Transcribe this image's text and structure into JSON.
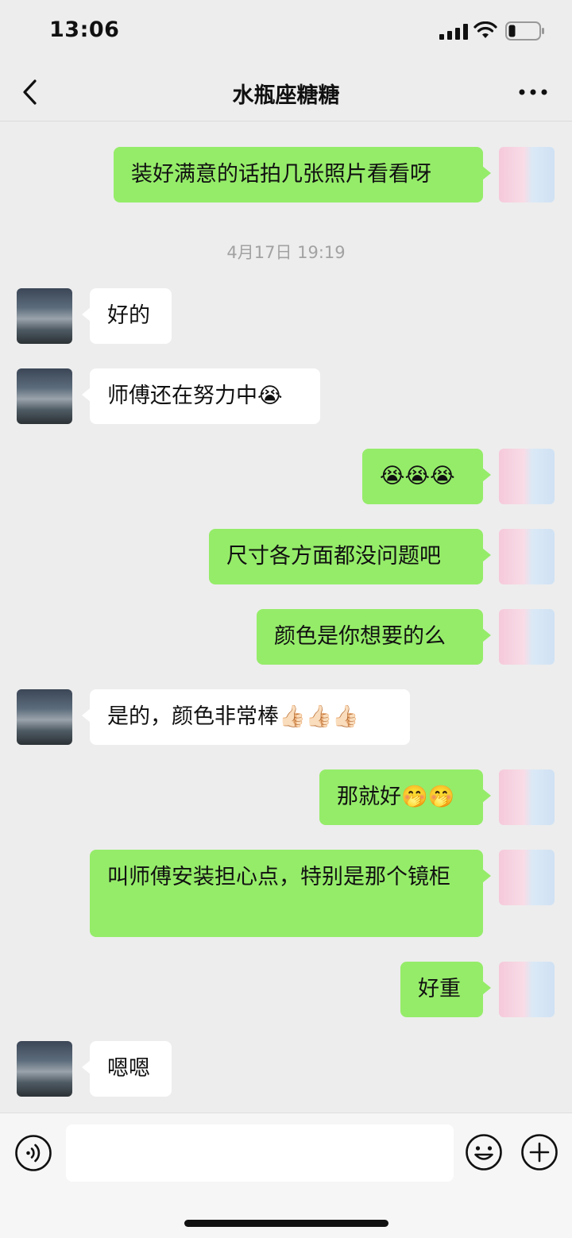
{
  "status_bar": {
    "time": "13:06"
  },
  "header": {
    "title": "水瓶座糖糖"
  },
  "timestamp": "4月17日 19:19",
  "messages": [
    {
      "side": "right",
      "text": "装好满意的话拍几张照片看看呀"
    },
    {
      "side": "left",
      "text": "好的"
    },
    {
      "side": "left",
      "text": "师傅还在努力中😭"
    },
    {
      "side": "right",
      "text": "😭😭😭"
    },
    {
      "side": "right",
      "text": "尺寸各方面都没问题吧"
    },
    {
      "side": "right",
      "text": "颜色是你想要的么"
    },
    {
      "side": "left",
      "text": "是的，颜色非常棒👍🏻👍🏻👍🏻"
    },
    {
      "side": "right",
      "text": "那就好🤭🤭"
    },
    {
      "side": "right",
      "text": "叫师傅安装担心点，特别是那个镜柜"
    },
    {
      "side": "right",
      "text": "好重"
    },
    {
      "side": "left",
      "text": "嗯嗯"
    }
  ],
  "input": {
    "placeholder": ""
  },
  "colors": {
    "self_bubble": "#95ec69",
    "other_bubble": "#ffffff",
    "background": "#ededed"
  }
}
